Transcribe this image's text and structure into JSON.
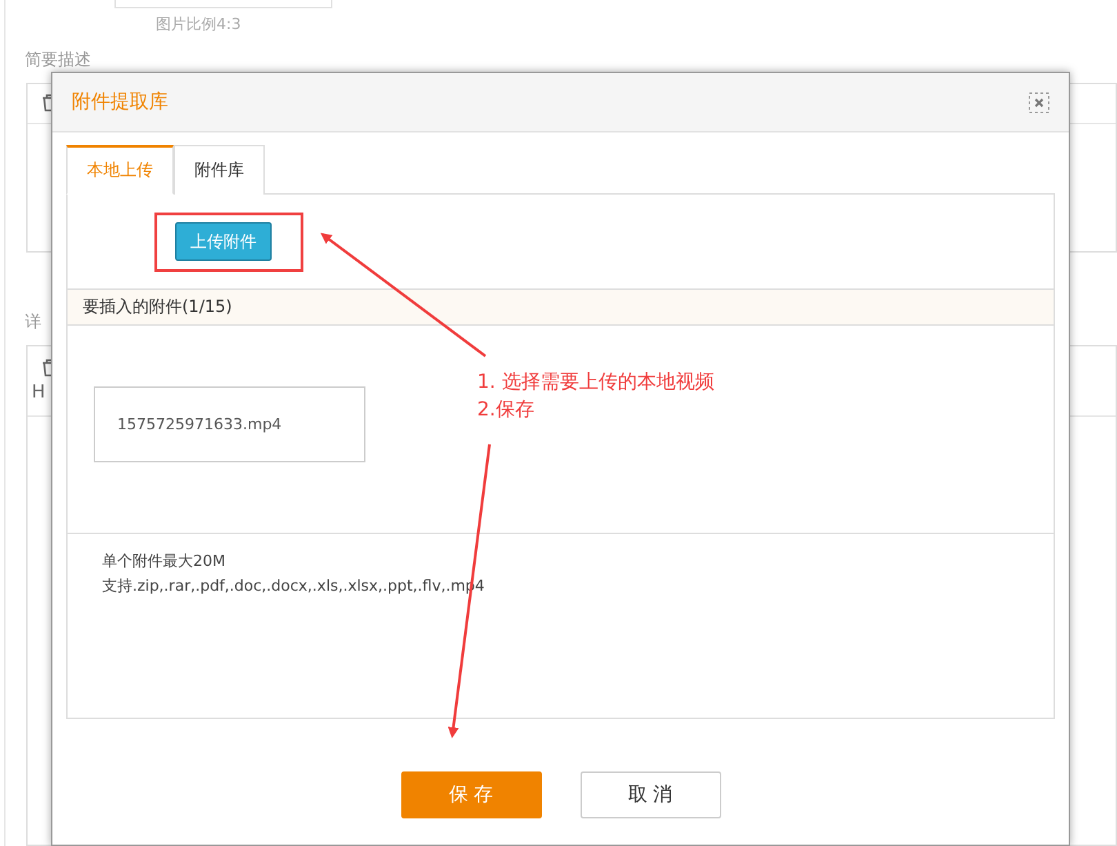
{
  "background": {
    "image_caption": "图片比例4:3",
    "summary_label": "简要描述",
    "detail_label": "详",
    "heading_button": "H"
  },
  "dialog": {
    "title": "附件提取库",
    "tabs": [
      {
        "label": "本地上传",
        "selected": true
      },
      {
        "label": "附件库",
        "selected": false
      }
    ],
    "upload_button": "上传附件",
    "attachments_header": "要插入的附件(1/15)",
    "files": [
      {
        "name": "1575725971633.mp4"
      }
    ],
    "notes": [
      "单个附件最大20M",
      "支持.zip,.rar,.pdf,.doc,.docx,.xls,.xlsx,.ppt,.flv,.mp4"
    ],
    "buttons": [
      {
        "label": "保 存",
        "kind": "primary"
      },
      {
        "label": "取 消",
        "kind": "secondary"
      }
    ]
  },
  "annotation": {
    "lines": [
      "1. 选择需要上传的本地视频",
      "2.保存"
    ]
  }
}
